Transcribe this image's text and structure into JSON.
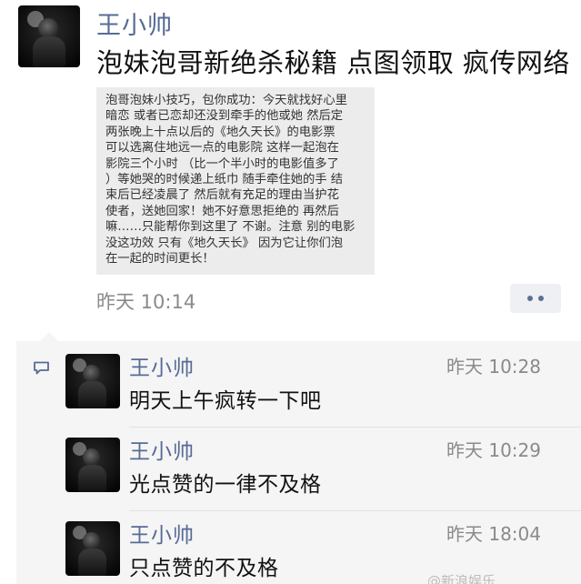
{
  "post": {
    "author": "王小帅",
    "text": "泡妹泡哥新绝杀秘籍 点图领取 疯传网络",
    "shared_text": "泡哥泡妹小技巧，包你成功：今天就找好心里\n暗恋 或者已恋却还没到牵手的他或她 然后定\n两张晚上十点以后的《地久天长》的电影票\n可以选离住地远一点的电影院 这样一起泡在\n影院三个小时 （比一个半小时的电影值多了\n）等她哭的时候递上纸巾 随手牵住她的手 结\n束后已经凌晨了 然后就有充足的理由当护花\n使者，送她回家！她不好意思拒绝的 再然后\n嘛……只能帮你到这里了 不谢。注意 别的电影\n没这功效 只有《地久天长》 因为它让你们泡\n在一起的时间更长！",
    "time": "昨天 10:14",
    "more_icon": "more-dots-icon"
  },
  "comments_icon": "comment-bubble-icon",
  "comments": [
    {
      "author": "王小帅",
      "text": "明天上午疯转一下吧",
      "time": "昨天 10:28"
    },
    {
      "author": "王小帅",
      "text": "光点赞的一律不及格",
      "time": "昨天 10:29"
    },
    {
      "author": "王小帅",
      "text": "只点赞的不及格",
      "time": "昨天 18:04"
    }
  ],
  "watermark": "@新浪娱乐",
  "colors": {
    "name": "#576b95",
    "text": "#111111",
    "time": "#8a8a8a",
    "card_bg": "#ececec",
    "comments_bg": "#f5f5f5"
  }
}
